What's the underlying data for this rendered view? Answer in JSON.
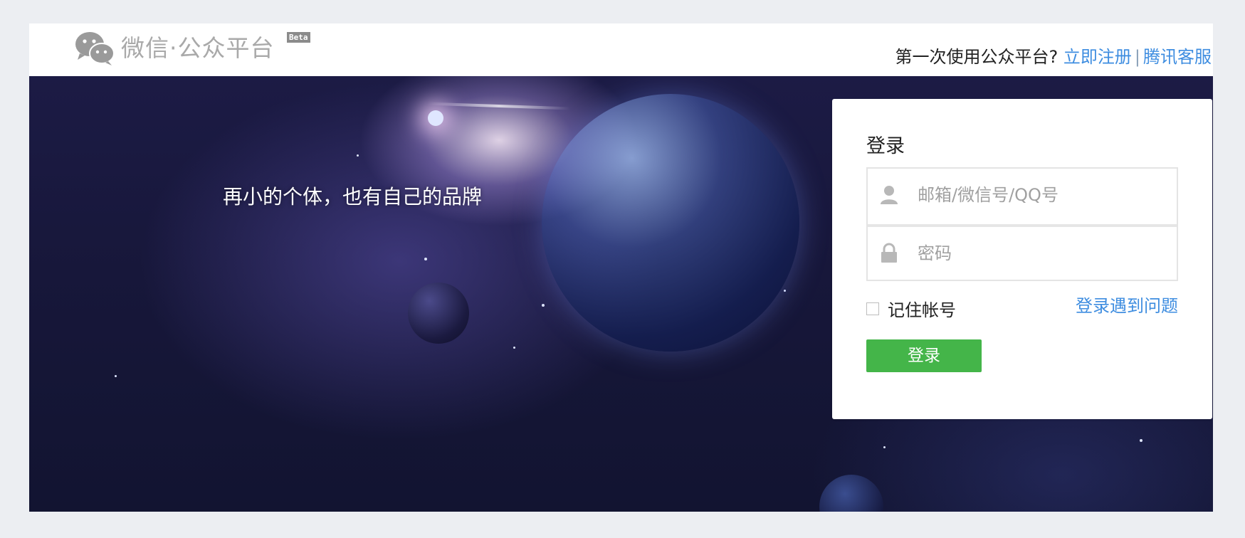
{
  "header": {
    "logo_text": "微信·公众平台",
    "beta_badge": "Beta",
    "first_time_text": "第一次使用公众平台?",
    "register_link": "立即注册",
    "separator": "|",
    "support_link": "腾讯客服"
  },
  "banner": {
    "tagline": "再小的个体，也有自己的品牌"
  },
  "login": {
    "title": "登录",
    "account_placeholder": "邮箱/微信号/QQ号",
    "account_value": "",
    "password_placeholder": "密码",
    "password_value": "",
    "remember_label": "记住帐号",
    "remember_checked": false,
    "help_link": "登录遇到问题",
    "submit_label": "登录"
  },
  "colors": {
    "accent_link": "#3e8de0",
    "submit_button": "#44b549",
    "page_background": "#eceef2"
  },
  "icons": {
    "logo": "wechat-logo-icon",
    "account": "user-icon",
    "password": "lock-icon"
  }
}
